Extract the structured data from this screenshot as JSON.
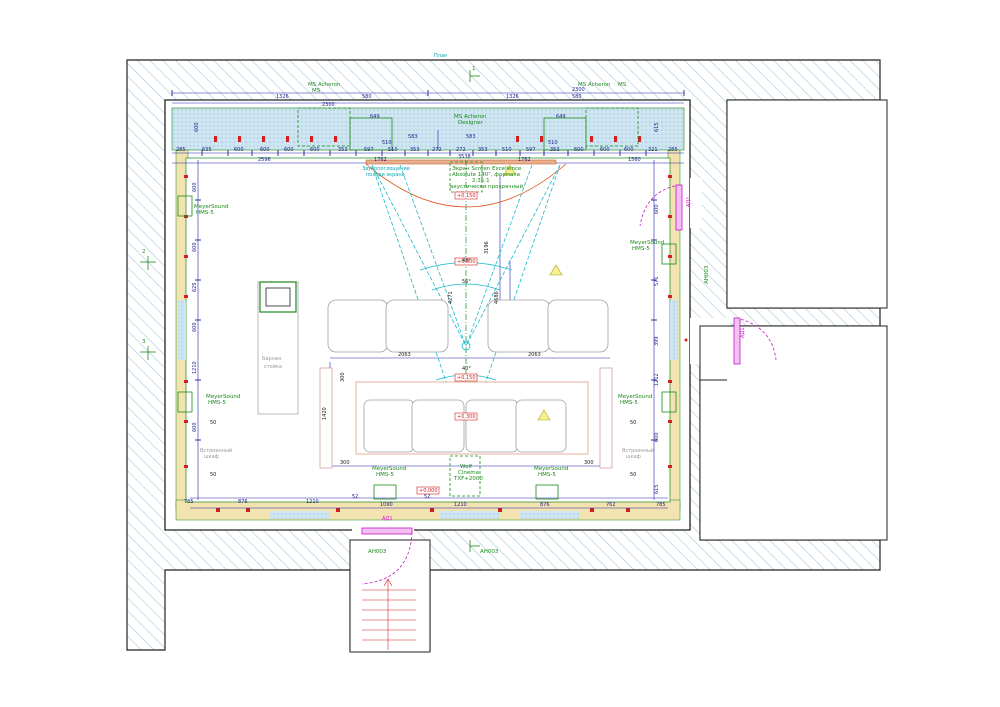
{
  "title": "План",
  "section_marks": [
    "1",
    "2",
    "3"
  ],
  "doors": [
    "АД1",
    "АД1",
    "АД1"
  ],
  "door_codes": [
    "АН003",
    "АН003",
    "АН003"
  ],
  "speakers": {
    "top_left": [
      "MS Acheron",
      "MS"
    ],
    "top_right": [
      "MS Acheron",
      "MS"
    ],
    "center_top": [
      "MS Acheron",
      "Designer"
    ],
    "left_upper": [
      "MeyerSound",
      "HMS-5"
    ],
    "left_lower": [
      "MeyerSound",
      "HMS-5"
    ],
    "right_upper": [
      "MeyerSound",
      "HMS-5"
    ],
    "right_lower": [
      "MeyerSound",
      "HMS-5"
    ],
    "bottom_left": [
      "MeyerSound",
      "HMS-5"
    ],
    "bottom_right": [
      "MeyerSound",
      "HMS-5"
    ],
    "sub": [
      "Wolf",
      "Cinema",
      "TXF+2000"
    ]
  },
  "screen_note": [
    "Экран Screen Excellence",
    "Absolute 140\", формата",
    "2,35:1",
    "акустически прозрачный"
  ],
  "fabric_note": [
    "Звукопоглощение",
    "позади экрана"
  ],
  "bar_label": [
    "Барная",
    "стойка"
  ],
  "niche_left": [
    "Встроенный",
    "шкаф"
  ],
  "niche_right": [
    "Встроенный",
    "шкаф"
  ],
  "angles": [
    "48°",
    "56°",
    "40°"
  ],
  "elevations": [
    "+0,150",
    "+0,000",
    "+0,150",
    "+0,300",
    "+0,000"
  ],
  "dims": {
    "top_chain": [
      "1326",
      "1326"
    ],
    "top_small": [
      "580",
      "580",
      "2300",
      "2300"
    ],
    "row_a": [
      "285",
      "635",
      "600",
      "600",
      "600",
      "600",
      "353",
      "597",
      "510",
      "353",
      "272",
      "272",
      "353",
      "510",
      "597",
      "353",
      "600",
      "600",
      "600",
      "321",
      "285"
    ],
    "row_b": [
      "2596",
      "1762",
      "1762",
      "1560"
    ],
    "center_a": [
      "583",
      "583"
    ],
    "center_b": [
      "3538"
    ],
    "verticals": [
      "3196",
      "4271",
      "4686"
    ],
    "left_side": [
      "600",
      "600",
      "600",
      "625",
      "600",
      "1210",
      "600"
    ],
    "right_side": [
      "615",
      "600",
      "571",
      "399",
      "1212",
      "600",
      "615"
    ],
    "seating": [
      "2063",
      "2063",
      "1420",
      "300",
      "300",
      "300"
    ],
    "bottom": [
      "785",
      "876",
      "1210",
      "1090",
      "52",
      "52",
      "1210",
      "876",
      "762",
      "785"
    ],
    "misc": [
      "50",
      "50",
      "50",
      "50",
      "649",
      "649",
      "510",
      "510"
    ]
  }
}
